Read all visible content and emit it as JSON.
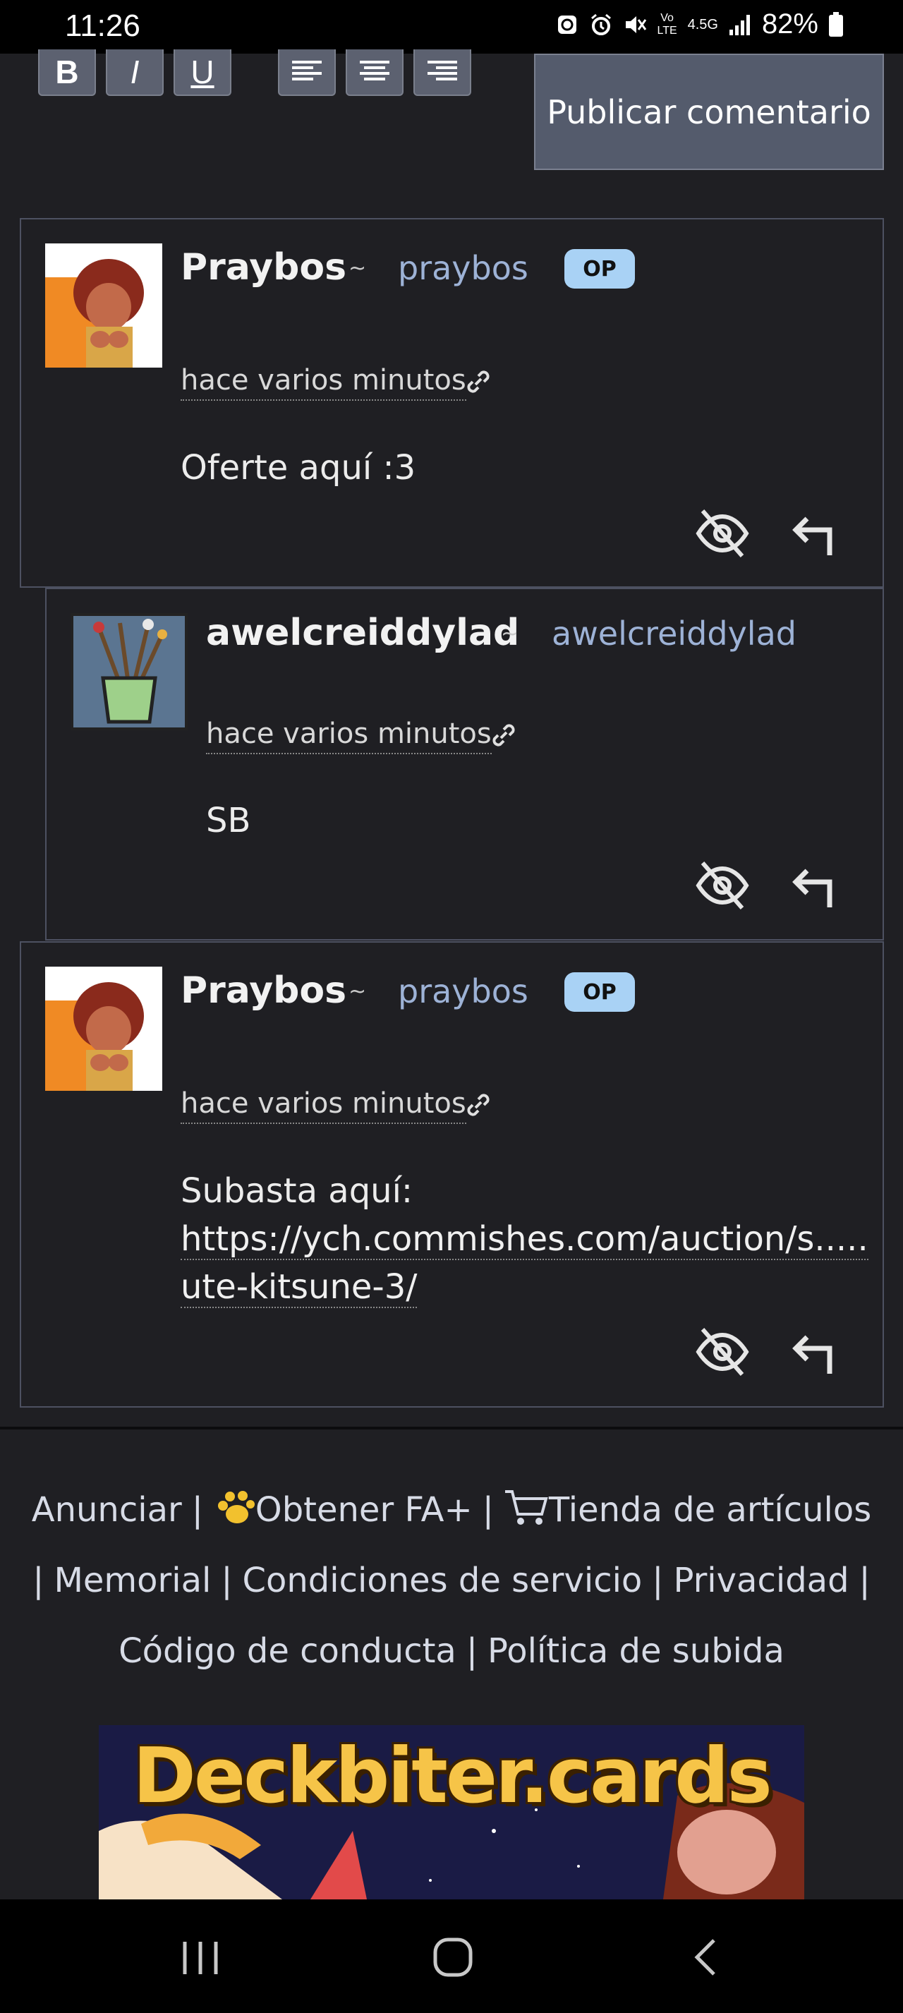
{
  "status_bar": {
    "time": "11:26",
    "network": "4.5G",
    "volte": "Vo LTE",
    "battery": "82%"
  },
  "editor": {
    "bold_label": "B",
    "italic_label": "I",
    "underline_label": "U",
    "submit_label": "Publicar comentario"
  },
  "comments": [
    {
      "username": "Praybos",
      "tilde": "~",
      "handle": "praybos",
      "badge": "OP",
      "timestamp": "hace varios minutos",
      "body": "Oferte aquí :3"
    },
    {
      "username": "awelcreiddylad",
      "tilde": "~",
      "handle": "awelcreiddylad",
      "timestamp": "hace varios minutos",
      "body": "SB"
    },
    {
      "username": "Praybos",
      "tilde": "~",
      "handle": "praybos",
      "badge": "OP",
      "timestamp": "hace varios minutos",
      "body_prefix": "Subasta aquí:",
      "link_line1": "https://ych.commishes.com/auction/s.....",
      "link_line2": "ute-kitsune-3/"
    }
  ],
  "footer": {
    "advertise": "Anunciar",
    "fa_plus": "Obtener FA+",
    "shop": "Tienda de artículos",
    "memorial": "Memorial",
    "terms": "Condiciones de servicio",
    "privacy": "Privacidad",
    "conduct": "Código de conducta",
    "upload_policy": "Política de subida",
    "separator": "|"
  },
  "banner": {
    "text": "Deckbiter.cards"
  }
}
